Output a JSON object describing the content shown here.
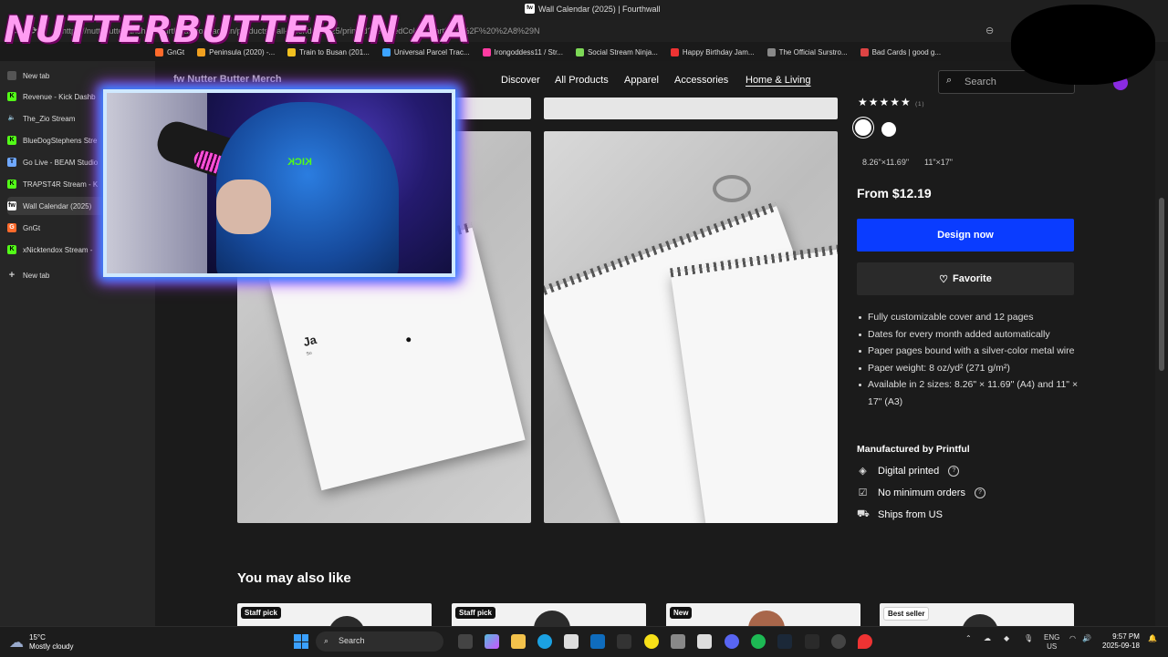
{
  "browser": {
    "window_title": "Wall Calendar (2025) | Fourthwall",
    "url": "https://nuttybutterfanshop.fourthwall.com/admin/products/wall-calendar-2025/printed?selectedColor=Start%2C%2F%20%2A8%29N",
    "favicon_text": "fw",
    "bookmarks": [
      "GnGt",
      "Peninsula (2020) -...",
      "Train to Busan (201...",
      "Universal Parcel Trac...",
      "Irongoddess11 / Str...",
      "Social Stream Ninja...",
      "Happy Birthday Jam...",
      "The Official Surstro...",
      "Bad Cards | good g..."
    ],
    "vertical_tabs": [
      {
        "label": "New tab",
        "icon": "newtab-icon",
        "color": "#cccccc"
      },
      {
        "label": "Revenue - Kick Dashb",
        "icon": "kick-icon",
        "color": "#53fc18"
      },
      {
        "label": "The_Zio Stream",
        "icon": "muted-speaker-icon",
        "color": "#aaaaaa"
      },
      {
        "label": "BlueDogStephens Stre",
        "icon": "kick-icon",
        "color": "#53fc18"
      },
      {
        "label": "Go Live - BEAM Studio",
        "icon": "beam-icon",
        "color": "#6fa8ff"
      },
      {
        "label": "TRAPST4R Stream - K",
        "icon": "kick-icon",
        "color": "#53fc18"
      },
      {
        "label": "Wall Calendar (2025)",
        "icon": "fourthwall-icon",
        "color": "#ffffff"
      },
      {
        "label": "GnGt",
        "icon": "gngt-icon",
        "color": "#ff6a2b"
      },
      {
        "label": "xNicktendox Stream -",
        "icon": "kick-icon",
        "color": "#53fc18"
      }
    ],
    "new_tab_label": "New tab",
    "plus_glyph": "+"
  },
  "overlay": {
    "watermark_text": "NUTTERBUTTER IN AA",
    "webcam_kick_text": "KICK"
  },
  "shop": {
    "brand": "Nutter Butter Merch",
    "brand_logo": "fw",
    "nav": [
      "Discover",
      "All Products",
      "Apparel",
      "Accessories",
      "Home & Living"
    ],
    "active_nav": "Home & Living",
    "search_placeholder": "Search",
    "calendar_month_text": "Ja",
    "calendar_sub_text": "Su"
  },
  "product": {
    "stars": "★★★★★",
    "rating_count": "(1)",
    "color_options": [
      "#ffffff",
      "#ffffff"
    ],
    "sizes": [
      "8.26\"×11.69\"",
      "11\"×17\""
    ],
    "price": "From $12.19",
    "design_button": "Design now",
    "favorite_button": "Favorite",
    "features": [
      "Fully customizable cover and 12 pages",
      "Dates for every month added automatically",
      "Paper pages bound with a silver-color metal wire",
      "Paper weight: 8 oz/yd² (271 g/m²)",
      "Available in 2 sizes: 8.26\" × 11.69\" (A4) and 11\" × 17\" (A3)"
    ],
    "manufacturer": "Manufactured by Printful",
    "attributes": [
      {
        "label": "Digital printed",
        "icon": "paint-bucket-icon",
        "has_help": true
      },
      {
        "label": "No minimum orders",
        "icon": "clipboard-check-icon",
        "has_help": true
      },
      {
        "label": "Ships from US",
        "icon": "truck-icon",
        "has_help": false
      }
    ]
  },
  "recommendations": {
    "title": "You may also like",
    "badges": [
      "Staff pick",
      "Staff pick",
      "New",
      "Best seller"
    ]
  },
  "taskbar": {
    "temperature": "15°C",
    "weather": "Mostly cloudy",
    "search_label": "Search",
    "lang": "ENG",
    "region": "US",
    "time": "9:57 PM",
    "date": "2025-09-18"
  }
}
